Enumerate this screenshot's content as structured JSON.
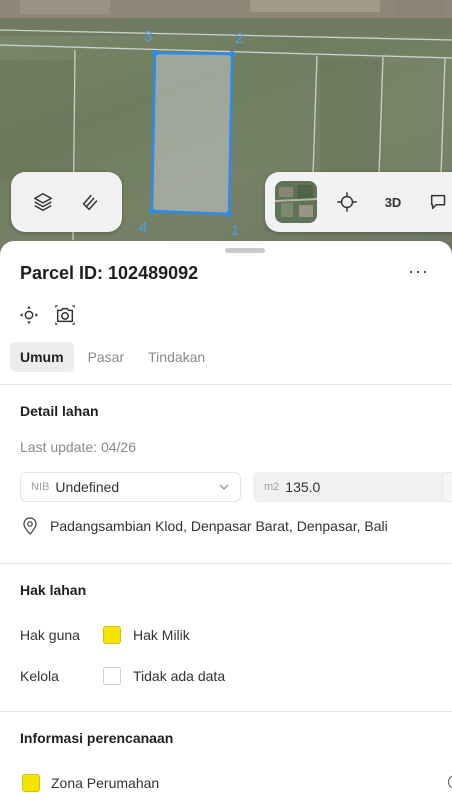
{
  "map": {
    "vertices": [
      "1",
      "2",
      "3",
      "4"
    ],
    "controls": {
      "layers_icon": "layers-icon",
      "measure_icon": "measure-icon",
      "basemap_icon": "satellite-thumbnail",
      "locate_icon": "crosshair-icon",
      "mode_3d_label": "3D",
      "share_icon": "chat-icon"
    },
    "colors": {
      "parcel_outline": "#2a8cf0",
      "parcel_fill": "#c8c8c8"
    }
  },
  "sheet": {
    "title": "Parcel ID: 102489092",
    "more_label": "···",
    "tools": [
      "crosshair-move-icon",
      "camera-icon"
    ],
    "tabs": [
      {
        "label": "Umum",
        "active": true
      },
      {
        "label": "Pasar",
        "active": false
      },
      {
        "label": "Tindakan",
        "active": false
      }
    ],
    "detail": {
      "heading": "Detail lahan",
      "last_update": "Last update: 04/26",
      "nib_prefix": "NIB",
      "nib_value": "Undefined",
      "area_prefix": "m2",
      "area_value": "135.0",
      "address": "Padangsambian Klod, Denpasar Barat, Denpasar, Bali"
    },
    "rights": {
      "heading": "Hak lahan",
      "rows": [
        {
          "label": "Hak guna",
          "value": "Hak Milik",
          "swatch": "#f5e400"
        },
        {
          "label": "Kelola",
          "value": "Tidak ada data",
          "swatch": "none"
        }
      ]
    },
    "planning": {
      "heading": "Informasi perencanaan",
      "zone": "Zona Perumahan",
      "zone_color": "#f5e400"
    }
  }
}
